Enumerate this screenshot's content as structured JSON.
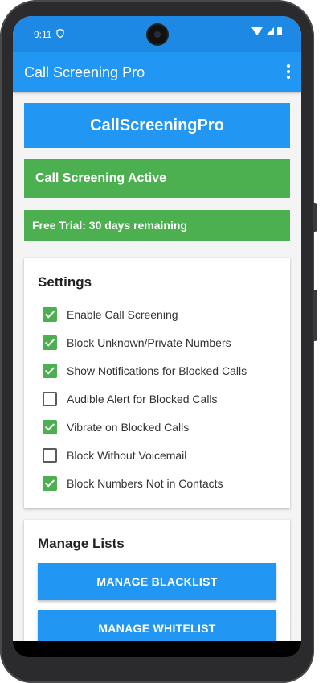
{
  "status_bar": {
    "time": "9:11"
  },
  "app_bar": {
    "title": "Call Screening Pro"
  },
  "brand": {
    "name": "CallScreeningPro"
  },
  "status": {
    "active_text": "Call Screening Active",
    "trial_text": "Free Trial: 30 days remaining"
  },
  "settings": {
    "title": "Settings",
    "items": [
      {
        "label": "Enable Call Screening",
        "checked": true
      },
      {
        "label": "Block Unknown/Private Numbers",
        "checked": true
      },
      {
        "label": "Show Notifications for Blocked Calls",
        "checked": true
      },
      {
        "label": "Audible Alert for Blocked Calls",
        "checked": false
      },
      {
        "label": "Vibrate on Blocked Calls",
        "checked": true
      },
      {
        "label": "Block Without Voicemail",
        "checked": false
      },
      {
        "label": "Block Numbers Not in Contacts",
        "checked": true
      }
    ]
  },
  "lists": {
    "title": "Manage Lists",
    "blacklist_label": "MANAGE BLACKLIST",
    "whitelist_label": "MANAGE WHITELIST"
  },
  "colors": {
    "primary": "#2196f3",
    "status_bar": "#1e88e5",
    "success": "#4caf50"
  }
}
